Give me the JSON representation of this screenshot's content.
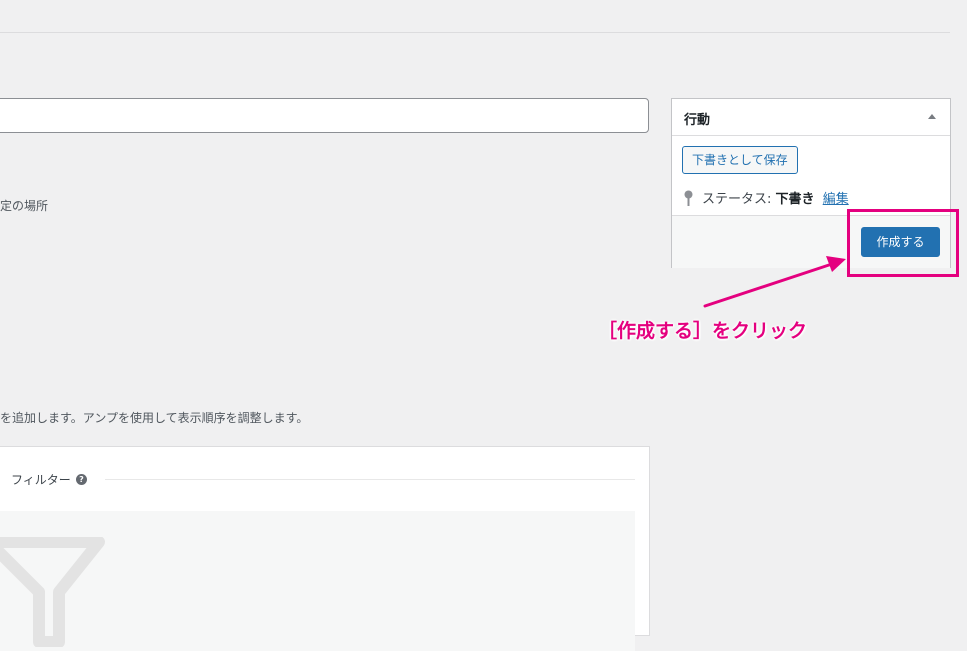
{
  "location_text": "定の場所",
  "help_text": "を追加します。アンプを使用して表示順序を調整します。",
  "filter": {
    "label": "フィルター",
    "help_glyph": "?"
  },
  "action_box": {
    "title": "行動",
    "draft_button": "下書きとして保存",
    "status_label": "ステータス:",
    "status_value": "下書き",
    "edit_link": "編集",
    "create_button": "作成する"
  },
  "annotation": {
    "callout": "［作成する］をクリック",
    "color": "#e4007f"
  },
  "colors": {
    "primary_button": "#2271b1",
    "background": "#f0f0f1"
  },
  "icons": [
    "help-icon",
    "funnel-icon",
    "pin-icon",
    "collapse-arrow-icon",
    "callout-arrow-icon"
  ]
}
